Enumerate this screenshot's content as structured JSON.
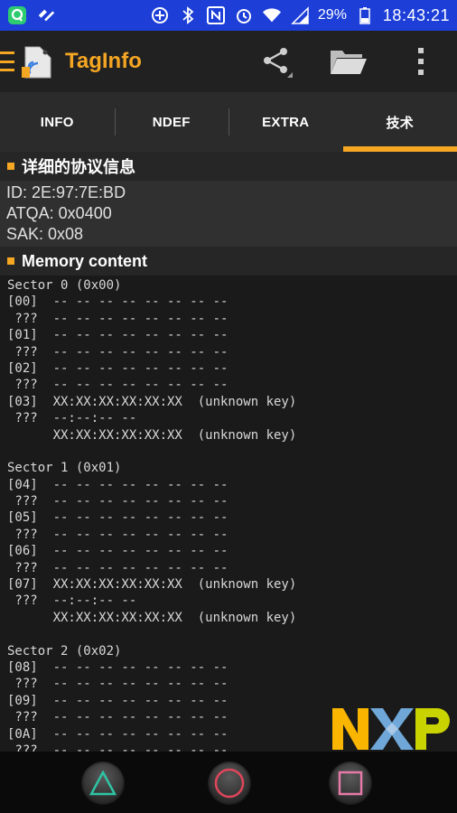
{
  "status_bar": {
    "battery_text": "29%",
    "time": "18:43:21"
  },
  "app": {
    "title": "TagInfo"
  },
  "tabs": [
    {
      "label": "INFO"
    },
    {
      "label": "NDEF"
    },
    {
      "label": "EXTRA"
    },
    {
      "label": "技术",
      "active": true
    }
  ],
  "protocol_section": {
    "title": "详细的协议信息",
    "lines": [
      "ID: 2E:97:7E:BD",
      "ATQA: 0x0400",
      "SAK: 0x08"
    ]
  },
  "memory_section": {
    "title": "Memory content",
    "lines": [
      "Sector 0 (0x00)",
      "[00]  -- -- -- -- -- -- -- --",
      " ???  -- -- -- -- -- -- -- --",
      "[01]  -- -- -- -- -- -- -- --",
      " ???  -- -- -- -- -- -- -- --",
      "[02]  -- -- -- -- -- -- -- --",
      " ???  -- -- -- -- -- -- -- --",
      "[03]  XX:XX:XX:XX:XX:XX  (unknown key)",
      " ???  --:--:-- --",
      "      XX:XX:XX:XX:XX:XX  (unknown key)",
      "",
      "Sector 1 (0x01)",
      "[04]  -- -- -- -- -- -- -- --",
      " ???  -- -- -- -- -- -- -- --",
      "[05]  -- -- -- -- -- -- -- --",
      " ???  -- -- -- -- -- -- -- --",
      "[06]  -- -- -- -- -- -- -- --",
      " ???  -- -- -- -- -- -- -- --",
      "[07]  XX:XX:XX:XX:XX:XX  (unknown key)",
      " ???  --:--:-- --",
      "      XX:XX:XX:XX:XX:XX  (unknown key)",
      "",
      "Sector 2 (0x02)",
      "[08]  -- -- -- -- -- -- -- --",
      " ???  -- -- -- -- -- -- -- --",
      "[09]  -- -- -- -- -- -- -- --",
      " ???  -- -- -- -- -- -- -- --",
      "[0A]  -- -- -- -- -- -- -- --",
      " ???  -- -- -- -- -- -- -- --"
    ]
  },
  "logo": {
    "text": "NXP"
  },
  "colors": {
    "accent": "#f5a623",
    "status_bar": "#1d3fd8",
    "nav_triangle": "#2ec4a4",
    "nav_circle": "#e0465a",
    "nav_square": "#e67aa8"
  },
  "icons": {
    "share": "share-icon",
    "folder": "folder-icon",
    "overflow": "more-vert-icon"
  }
}
